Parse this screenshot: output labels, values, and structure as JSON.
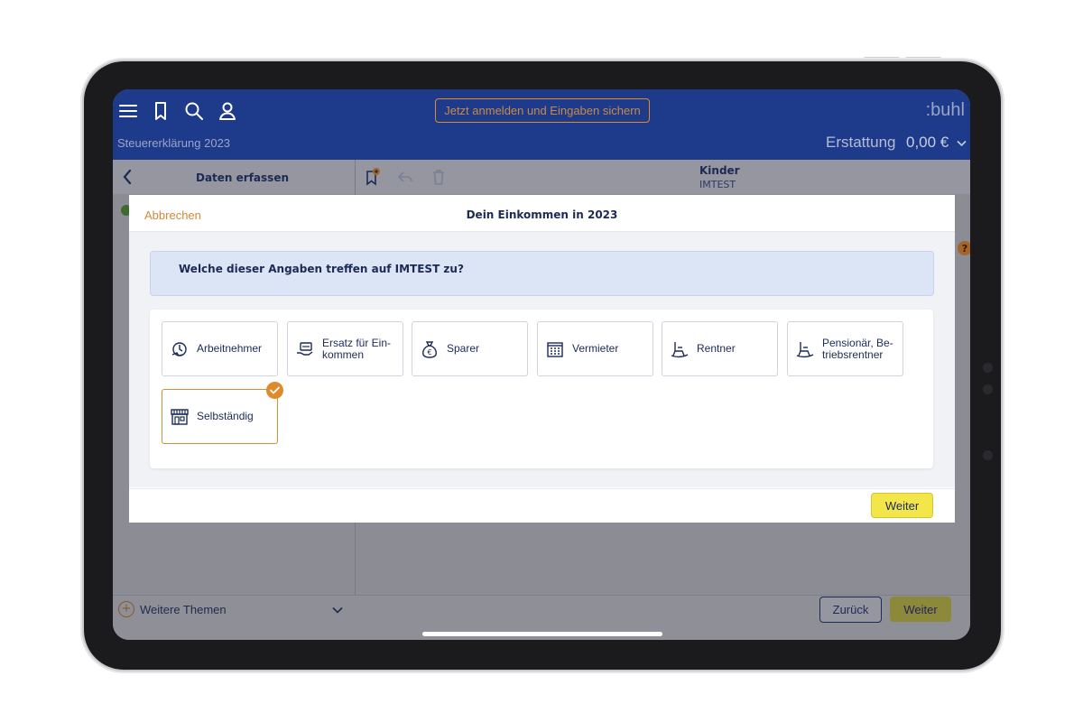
{
  "header": {
    "login_button": "Jetzt anmelden und Eingaben sichern",
    "brand": ":buhl",
    "document_title": "Steuererklärung 2023",
    "refund_label": "Erstattung",
    "refund_amount": "0,00 €"
  },
  "left_panel": {
    "title": "Daten erfassen",
    "more_topics": "Weitere Themen"
  },
  "content_header": {
    "section": "Kinder",
    "person": "IMTEST"
  },
  "footer": {
    "back": "Zurück",
    "next": "Weiter"
  },
  "modal": {
    "cancel": "Abbrechen",
    "title": "Dein Einkommen in 2023",
    "question": "Welche dieser Angaben treffen auf IMTEST zu?",
    "next": "Weiter",
    "options": [
      {
        "label": "Arbeitnehmer",
        "icon": "employee-icon",
        "selected": false
      },
      {
        "label": "Ersatz für Ein-\nkommen",
        "icon": "income-replacement-icon",
        "selected": false
      },
      {
        "label": "Sparer",
        "icon": "money-bag-icon",
        "selected": false
      },
      {
        "label": "Vermieter",
        "icon": "building-icon",
        "selected": false
      },
      {
        "label": "Rentner",
        "icon": "rocking-chair-icon",
        "selected": false
      },
      {
        "label": "Pensionär, Be-\ntriebsrentner",
        "icon": "rocking-chair-icon",
        "selected": false
      },
      {
        "label": "Selbständig",
        "icon": "shop-icon",
        "selected": true
      }
    ]
  },
  "colors": {
    "header_bg": "#1e3a8a",
    "accent_orange": "#e08a2c",
    "primary_navy": "#1c2a55",
    "next_yellow": "#f3e64a"
  }
}
